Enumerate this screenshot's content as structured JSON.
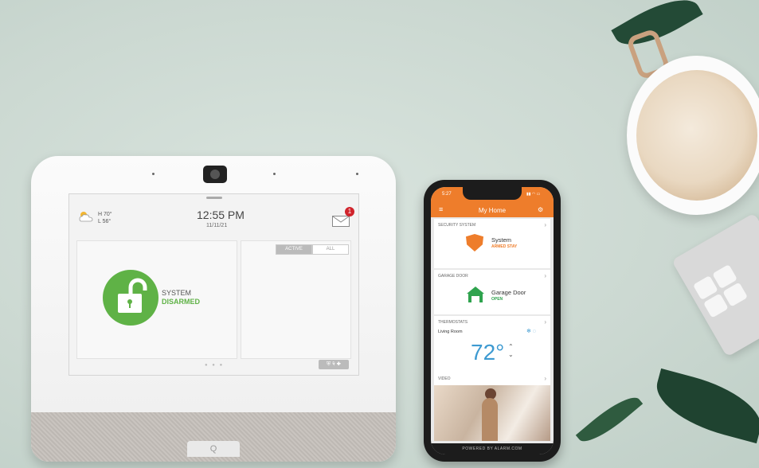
{
  "panel": {
    "weather": {
      "high": "H 70°",
      "low": "L 56°"
    },
    "time": "12:55 PM",
    "date": "11/11/21",
    "mail_badge": "1",
    "status_line1": "SYSTEM",
    "status_line2": "DISARMED",
    "tab_active": "ACTIVE",
    "tab_all": "ALL",
    "speaker_badge": "Q"
  },
  "phone": {
    "status_time": "5:27",
    "title": "My Home",
    "sections": {
      "security": {
        "label": "SECURITY SYSTEM",
        "item": "System",
        "status": "ARMED STAY"
      },
      "garage": {
        "label": "GARAGE DOOR",
        "item": "Garage Door",
        "status": "OPEN"
      },
      "thermostats": {
        "label": "THERMOSTATS",
        "room": "Living Room",
        "temp": "72°"
      },
      "video": {
        "label": "VIDEO"
      }
    },
    "footer": "POWERED BY ALARM.COM"
  },
  "colors": {
    "accent_orange": "#ee7d2b",
    "disarmed_green": "#5fb246",
    "temp_blue": "#3d9ad1"
  }
}
